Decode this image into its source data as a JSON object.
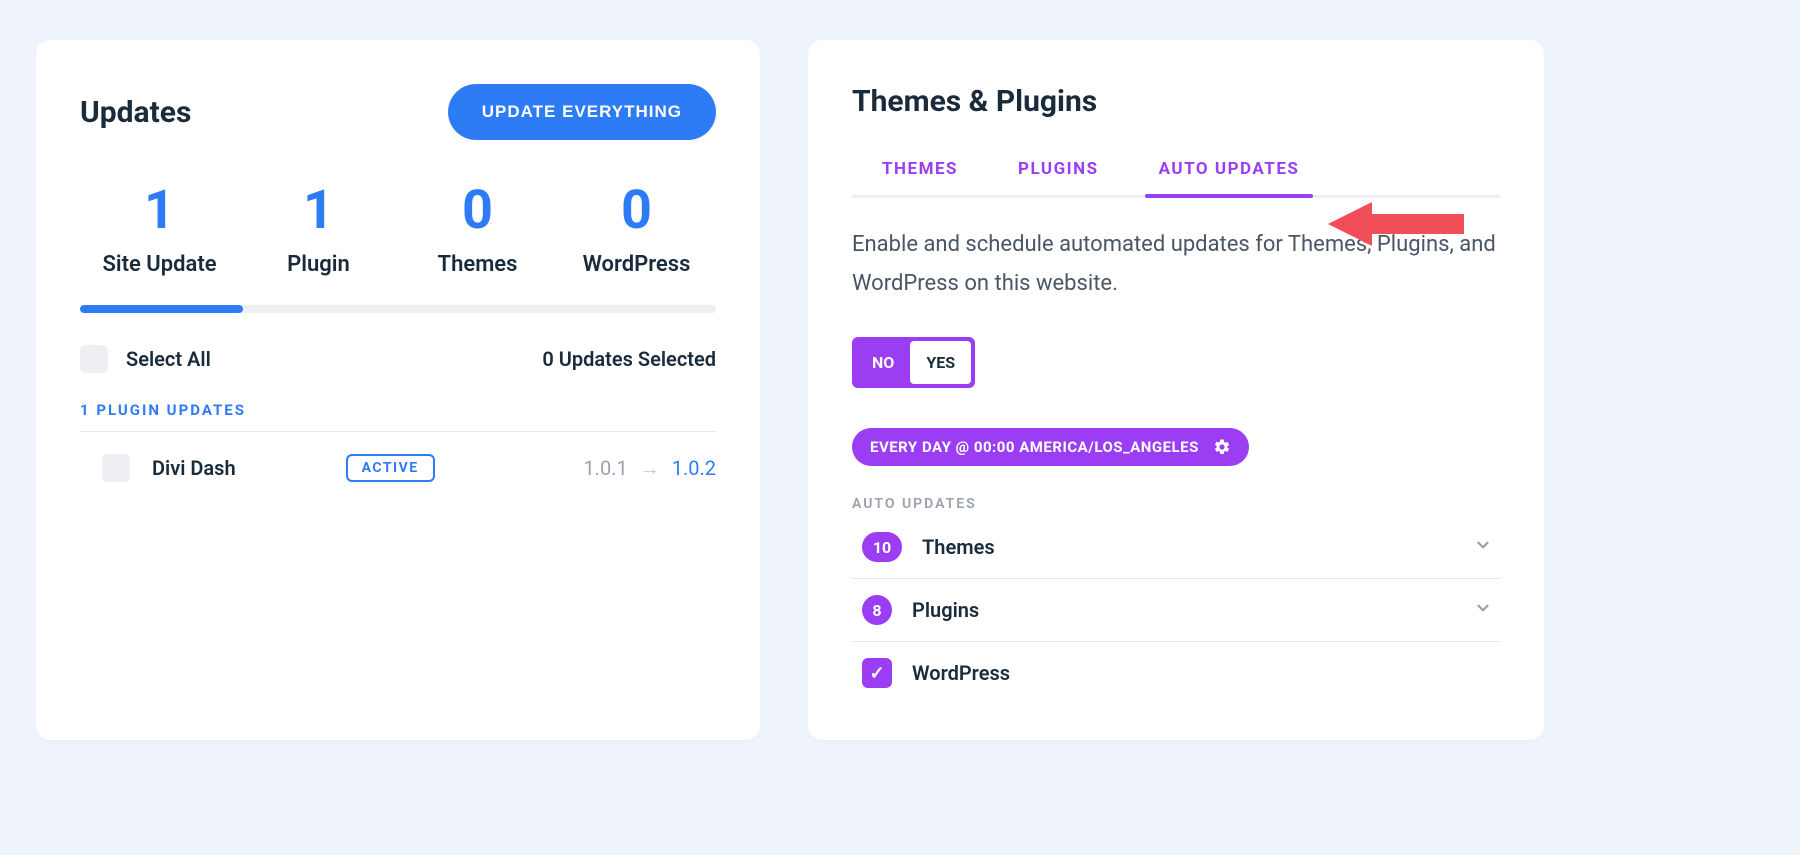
{
  "updates": {
    "title": "Updates",
    "update_everything_label": "UPDATE EVERYTHING",
    "stats": {
      "site_update": {
        "count": "1",
        "label": "Site Update"
      },
      "plugin": {
        "count": "1",
        "label": "Plugin"
      },
      "themes": {
        "count": "0",
        "label": "Themes"
      },
      "wordpress": {
        "count": "0",
        "label": "WordPress"
      }
    },
    "select_all_label": "Select All",
    "updates_selected_text": "0 Updates Selected",
    "plugin_updates_heading": "1 PLUGIN UPDATES",
    "plugin": {
      "name": "Divi Dash",
      "status": "ACTIVE",
      "version_old": "1.0.1",
      "version_new": "1.0.2"
    }
  },
  "themes_plugins": {
    "title": "Themes & Plugins",
    "tabs": {
      "themes": "THEMES",
      "plugins": "PLUGINS",
      "auto_updates": "AUTO UPDATES"
    },
    "description": "Enable and schedule automated updates for Themes, Plugins, and WordPress on this website.",
    "toggle": {
      "no": "NO",
      "yes": "YES",
      "selected": "YES"
    },
    "schedule_pill": "EVERY DAY @ 00:00  AMERICA/LOS_ANGELES",
    "auto_updates_label": "AUTO UPDATES",
    "rows": {
      "themes": {
        "count": "10",
        "label": "Themes"
      },
      "plugins": {
        "count": "8",
        "label": "Plugins"
      },
      "wordpress": {
        "label": "WordPress",
        "checked": true
      }
    }
  }
}
